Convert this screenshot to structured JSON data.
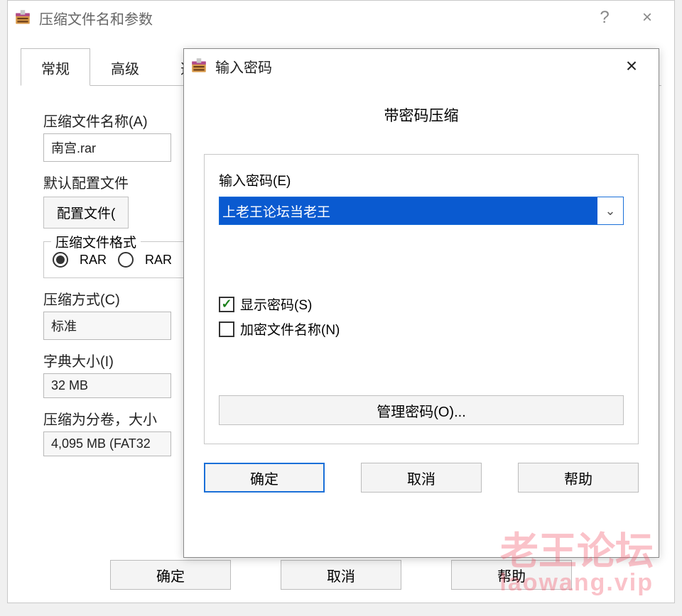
{
  "main_window": {
    "title": "压缩文件名和参数",
    "help_symbol": "?",
    "close_symbol": "×",
    "tabs": {
      "general": "常规",
      "advanced": "高级",
      "partial": "选"
    },
    "filename_label": "压缩文件名称(A)",
    "filename_value": "南宫.rar",
    "default_profile_label": "默认配置文件",
    "profile_button": "配置文件(",
    "format_group": "压缩文件格式",
    "format_rar": "RAR",
    "format_rar2": "RAR",
    "method_label": "压缩方式(C)",
    "method_value": "标准",
    "dict_label": "字典大小(I)",
    "dict_value": "32 MB",
    "split_label": "压缩为分卷，大小",
    "split_value": "4,095 MB  (FAT32",
    "ok": "确定",
    "cancel": "取消",
    "help": "帮助"
  },
  "modal": {
    "title": "输入密码",
    "close_symbol": "×",
    "heading": "带密码压缩",
    "pw_label": "输入密码(E)",
    "pw_value": "上老王论坛当老王",
    "show_pw": "显示密码(S)",
    "encrypt_names": "加密文件名称(N)",
    "manage": "管理密码(O)...",
    "ok": "确定",
    "cancel": "取消",
    "help": "帮助"
  },
  "watermark": {
    "line1": "老王论坛",
    "line2": "laowang.vip"
  }
}
